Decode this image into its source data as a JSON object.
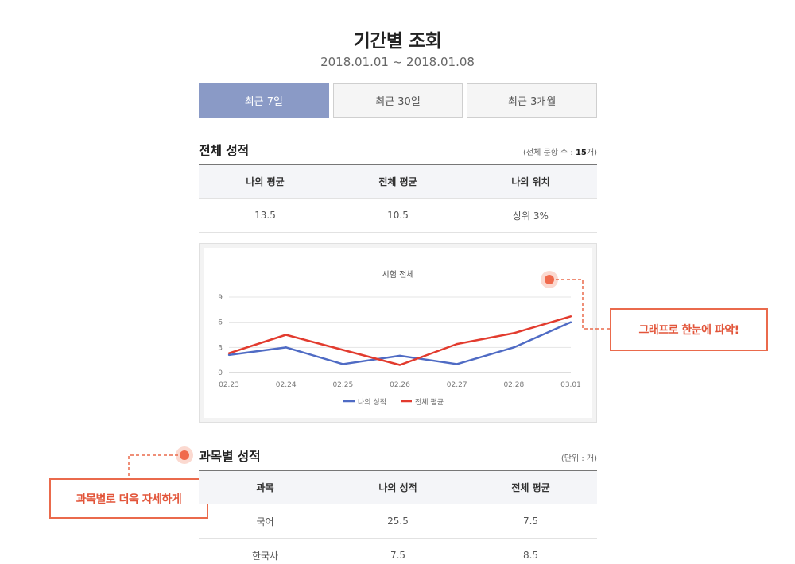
{
  "header": {
    "title": "기간별 조회",
    "date_range": "2018.01.01 ~ 2018.01.08"
  },
  "tabs": [
    {
      "label": "최근 7일",
      "active": true
    },
    {
      "label": "최근 30일",
      "active": false
    },
    {
      "label": "최근 3개월",
      "active": false
    }
  ],
  "overall": {
    "title": "전체 성적",
    "note_prefix": "(전체 문항 수 : ",
    "note_count": "15",
    "note_suffix": "개)",
    "headers": [
      "나의 평균",
      "전체 평균",
      "나의 위치"
    ],
    "values": [
      "13.5",
      "10.5",
      "상위 3%"
    ]
  },
  "chart_data": {
    "type": "line",
    "title": "시험 전체",
    "categories": [
      "02.23",
      "02.24",
      "02.25",
      "02.26",
      "02.27",
      "02.28",
      "03.01"
    ],
    "y_ticks": [
      "0",
      "3",
      "6",
      "9"
    ],
    "ylim": [
      0,
      9
    ],
    "grid": true,
    "legend_placement": "bottom",
    "series": [
      {
        "name": "나의 성적",
        "color": "#4f6bc4",
        "values": [
          2.1,
          3.0,
          1.0,
          2.0,
          1.0,
          3.0,
          6.0
        ]
      },
      {
        "name": "전체 평균",
        "color": "#e23b2e",
        "values": [
          2.3,
          4.5,
          2.7,
          0.9,
          3.4,
          4.7,
          6.7
        ]
      }
    ]
  },
  "callouts": {
    "graph": "그래프로 한눈에 파악!",
    "subject": "과목별로 더욱 자세하게"
  },
  "subjects": {
    "title": "과목별 성적",
    "note": "(단위 : 개)",
    "headers": [
      "과목",
      "나의 성적",
      "전체 평균"
    ],
    "rows": [
      [
        "국어",
        "25.5",
        "7.5"
      ],
      [
        "한국사",
        "7.5",
        "8.5"
      ]
    ]
  },
  "colors": {
    "accent_tab": "#8a9ac6",
    "callout": "#ea6a4c"
  }
}
